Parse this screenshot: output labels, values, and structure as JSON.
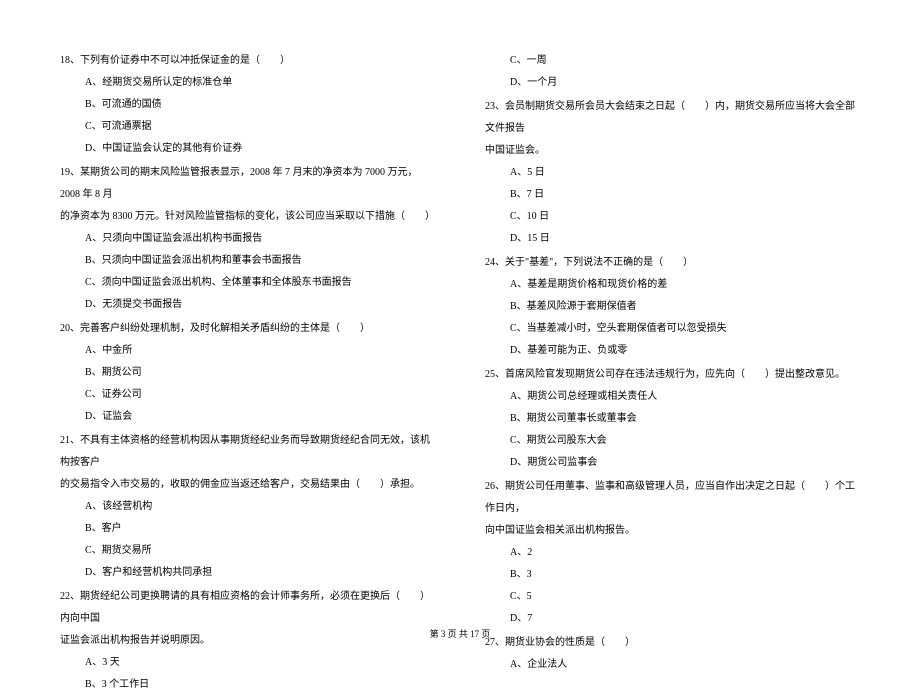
{
  "left": {
    "q18": {
      "text": "18、下列有价证券中不可以冲抵保证金的是（　　）",
      "opts": [
        "A、经期货交易所认定的标准仓单",
        "B、可流通的国债",
        "C、可流通票据",
        "D、中国证监会认定的其他有价证券"
      ]
    },
    "q19": {
      "line1": "19、某期货公司的期末风险监管报表显示，2008 年 7 月末的净资本为 7000 万元，2008 年 8 月",
      "line2": "的净资本为 8300 万元。针对风险监管指标的变化，该公司应当采取以下措施（　　）",
      "opts": [
        "A、只须向中国证监会派出机构书面报告",
        "B、只须向中国证监会派出机构和董事会书面报告",
        "C、须向中国证监会派出机构、全体董事和全体股东书面报告",
        "D、无须提交书面报告"
      ]
    },
    "q20": {
      "text": "20、完善客户纠纷处理机制，及时化解相关矛盾纠纷的主体是（　　）",
      "opts": [
        "A、中金所",
        "B、期货公司",
        "C、证券公司",
        "D、证监会"
      ]
    },
    "q21": {
      "line1": "21、不具有主体资格的经营机构因从事期货经纪业务而导致期货经纪合同无效，该机构按客户",
      "line2": "的交易指令入市交易的，收取的佣金应当返还给客户，交易结果由（　　）承担。",
      "opts": [
        "A、该经营机构",
        "B、客户",
        "C、期货交易所",
        "D、客户和经营机构共同承担"
      ]
    },
    "q22": {
      "line1": "22、期货经纪公司更换聘请的具有相应资格的会计师事务所，必须在更换后（　　）内向中国",
      "line2": "证监会派出机构报告并说明原因。",
      "opts": [
        "A、3 天",
        "B、3 个工作日"
      ]
    }
  },
  "right": {
    "q22_cont": {
      "opts": [
        "C、一周",
        "D、一个月"
      ]
    },
    "q23": {
      "line1": "23、会员制期货交易所会员大会结束之日起（　　）内，期货交易所应当将大会全部文件报告",
      "line2": "中国证监会。",
      "opts": [
        "A、5 日",
        "B、7 日",
        "C、10 日",
        "D、15 日"
      ]
    },
    "q24": {
      "text": "24、关于\"基差\"，下列说法不正确的是（　　）",
      "opts": [
        "A、基差是期货价格和现货价格的差",
        "B、基差风险源于套期保值者",
        "C、当基差减小时，空头套期保值者可以忽受损失",
        "D、基差可能为正、负或零"
      ]
    },
    "q25": {
      "text": "25、首席风险官发现期货公司存在违法违规行为，应先向（　　）提出整改意见。",
      "opts": [
        "A、期货公司总经理或相关责任人",
        "B、期货公司董事长或董事会",
        "C、期货公司股东大会",
        "D、期货公司监事会"
      ]
    },
    "q26": {
      "line1": "26、期货公司任用董事、监事和高级管理人员，应当自作出决定之日起（　　）个工作日内，",
      "line2": "向中国证监会相关派出机构报告。",
      "opts": [
        "A、2",
        "B、3",
        "C、5",
        "D、7"
      ]
    },
    "q27": {
      "text": "27、期货业协会的性质是（　　）",
      "opts": [
        "A、企业法人"
      ]
    }
  },
  "footer": "第 3 页 共 17 页"
}
